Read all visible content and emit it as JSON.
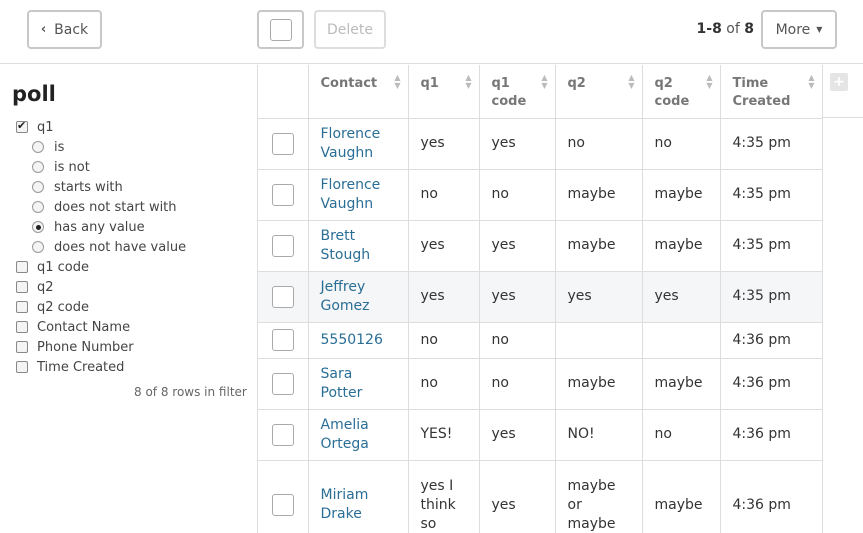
{
  "toolbar": {
    "back_label": "Back",
    "delete_label": "Delete",
    "pager_range": "1-8",
    "pager_of": "of",
    "pager_total": "8",
    "more_label": "More"
  },
  "sidebar": {
    "title": "poll",
    "filters": [
      {
        "label": "q1",
        "kind": "checkbox",
        "checked": true
      },
      {
        "label": "is",
        "kind": "radio",
        "checked": false
      },
      {
        "label": "is not",
        "kind": "radio",
        "checked": false
      },
      {
        "label": "starts with",
        "kind": "radio",
        "checked": false
      },
      {
        "label": "does not start with",
        "kind": "radio",
        "checked": false
      },
      {
        "label": "has any value",
        "kind": "radio",
        "checked": true
      },
      {
        "label": "does not have value",
        "kind": "radio",
        "checked": false
      },
      {
        "label": "q1 code",
        "kind": "checkbox",
        "checked": false
      },
      {
        "label": "q2",
        "kind": "checkbox",
        "checked": false
      },
      {
        "label": "q2 code",
        "kind": "checkbox",
        "checked": false
      },
      {
        "label": "Contact Name",
        "kind": "checkbox",
        "checked": false
      },
      {
        "label": "Phone Number",
        "kind": "checkbox",
        "checked": false
      },
      {
        "label": "Time Created",
        "kind": "checkbox",
        "checked": false
      }
    ],
    "rows_count": "8 of 8 rows in filter"
  },
  "table": {
    "headers": [
      "Contact",
      "q1",
      "q1 code",
      "q2",
      "q2 code",
      "Time Created"
    ],
    "rows": [
      {
        "contact": "Florence Vaughn",
        "q1": "yes",
        "q1code": "yes",
        "q2": "no",
        "q2code": "no",
        "time": "4:35 pm"
      },
      {
        "contact": "Florence Vaughn",
        "q1": "no",
        "q1code": "no",
        "q2": "maybe",
        "q2code": "maybe",
        "time": "4:35 pm"
      },
      {
        "contact": "Brett Stough",
        "q1": "yes",
        "q1code": "yes",
        "q2": "maybe",
        "q2code": "maybe",
        "time": "4:35 pm"
      },
      {
        "contact": "Jeffrey Gomez",
        "q1": "yes",
        "q1code": "yes",
        "q2": "yes",
        "q2code": "yes",
        "time": "4:35 pm"
      },
      {
        "contact": "5550126",
        "q1": "no",
        "q1code": "no",
        "q2": "",
        "q2code": "",
        "time": "4:36 pm"
      },
      {
        "contact": "Sara Potter",
        "q1": "no",
        "q1code": "no",
        "q2": "maybe",
        "q2code": "maybe",
        "time": "4:36 pm"
      },
      {
        "contact": "Amelia Ortega",
        "q1": "YES!",
        "q1code": "yes",
        "q2": "NO!",
        "q2code": "no",
        "time": "4:36 pm"
      },
      {
        "contact": "Miriam Drake",
        "q1": "yes I think so",
        "q1code": "yes",
        "q2": "maybe or maybe not",
        "q2code": "maybe",
        "time": "4:36 pm"
      }
    ]
  },
  "colors": {
    "link": "#2a6e96",
    "border": "#dddddd",
    "highlight_row": "#f5f6f7"
  }
}
